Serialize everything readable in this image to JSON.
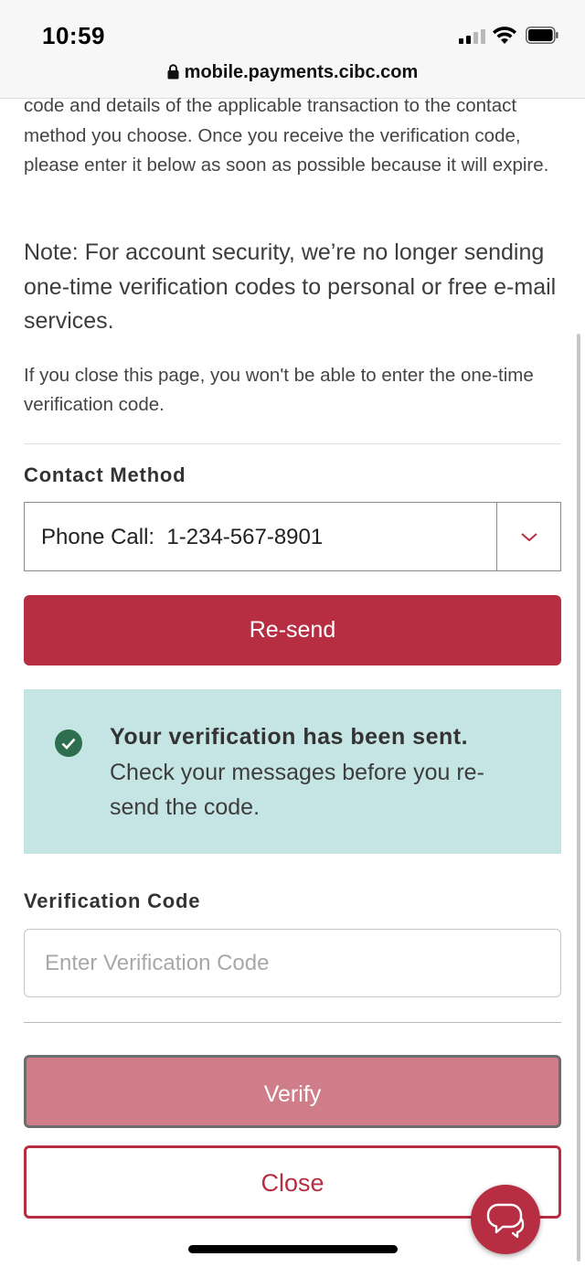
{
  "status_bar": {
    "time": "10:59"
  },
  "browser": {
    "url": "mobile.payments.cibc.com"
  },
  "intro": {
    "paragraph_1": "code and details of the applicable transaction to the contact method you choose. Once you receive the verification code, please enter it below as soon as possible because it will expire.",
    "note": "Note: For account security, we’re no longer sending one-time verification codes to personal or free e-mail services.",
    "warning": "If you close this page, you won't be able to enter the one-time verification code."
  },
  "contact_method": {
    "label": "Contact Method",
    "selected": "Phone Call:  1-234-567-8901"
  },
  "buttons": {
    "resend": "Re-send",
    "verify": "Verify",
    "close": "Close"
  },
  "alert": {
    "title": "Your verification has been sent.",
    "body": "Check your messages before you re-send the code."
  },
  "verification_code": {
    "label": "Verification Code",
    "placeholder": "Enter Verification Code",
    "value": ""
  },
  "colors": {
    "brand_red": "#b72d42",
    "verify_disabled": "#cf7d88",
    "alert_background": "#c5e5e4",
    "success_green": "#2d6e4e"
  }
}
